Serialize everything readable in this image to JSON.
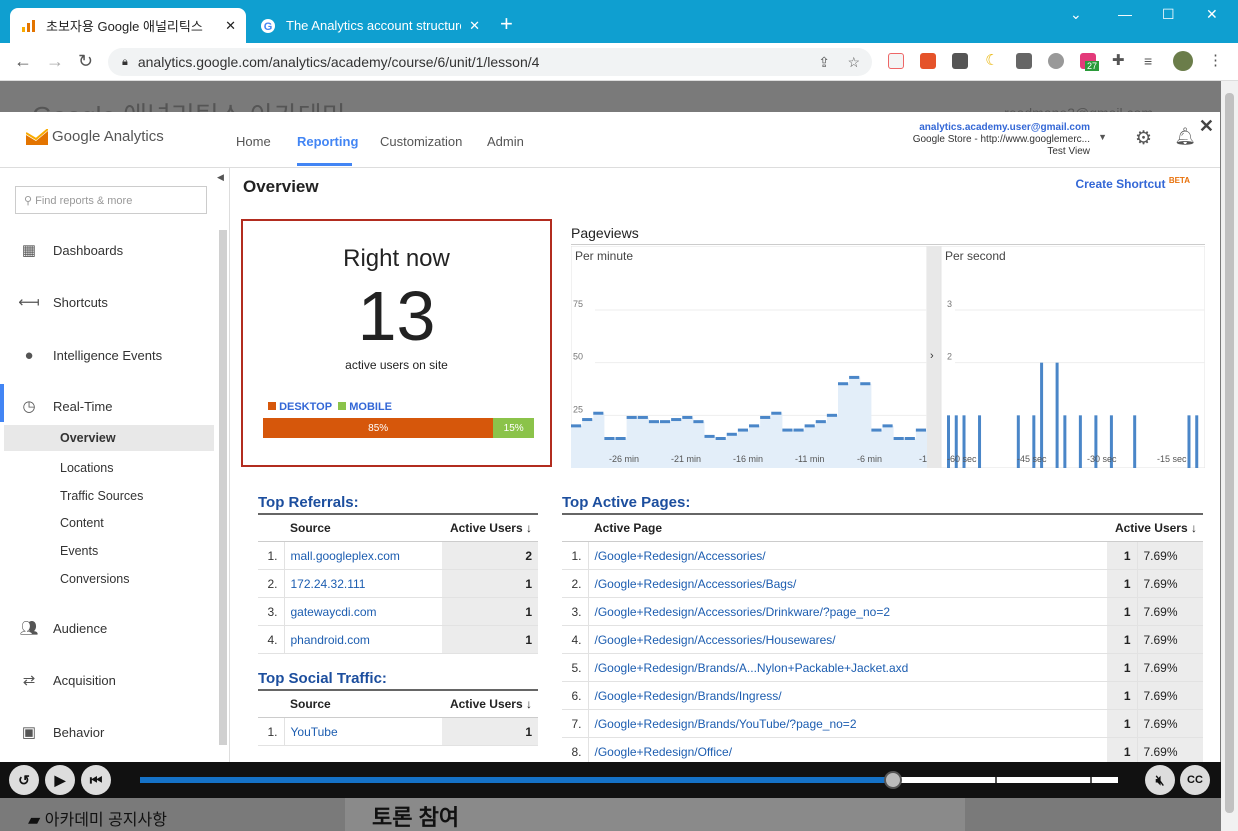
{
  "browser": {
    "tabs": [
      {
        "title": "초보자용 Google 애널리틱스",
        "active": true
      },
      {
        "title": "The Analytics account structure",
        "active": false
      }
    ],
    "url": "analytics.google.com/analytics/academy/course/6/unit/1/lesson/4",
    "extension_badge": "27"
  },
  "background": {
    "academy_title": "Google 애널리틱스 아카데미",
    "account_email": "readmane3@gmail.com"
  },
  "ga": {
    "logo_text": "Google Analytics",
    "nav": [
      "Home",
      "Reporting",
      "Customization",
      "Admin"
    ],
    "user": {
      "email": "analytics.academy.user@gmail.com",
      "property": "Google Store - http://www.googlemerc...",
      "view": "Test View"
    },
    "sidebar": {
      "search_placeholder": "Find reports & more",
      "items": [
        "Dashboards",
        "Shortcuts",
        "Intelligence Events",
        "Real-Time"
      ],
      "realtime_sub": [
        "Overview",
        "Locations",
        "Traffic Sources",
        "Content",
        "Events",
        "Conversions"
      ],
      "more": [
        "Audience",
        "Acquisition",
        "Behavior"
      ]
    },
    "main": {
      "title": "Overview",
      "shortcut": "Create Shortcut",
      "shortcut_badge": "BETA",
      "right_now": {
        "title": "Right now",
        "count": "13",
        "subtitle": "active users on site",
        "desktop_label": "DESKTOP",
        "mobile_label": "MOBILE",
        "desktop_pct": "85%",
        "mobile_pct": "15%",
        "desktop_fraction": 0.85
      },
      "pageviews": {
        "title": "Pageviews",
        "per_minute": "Per minute",
        "per_second": "Per second"
      },
      "top_referrals": {
        "title": "Top Referrals:",
        "col1": "Source",
        "col2": "Active Users",
        "rows": [
          {
            "n": "1.",
            "source": "mall.googleplex.com",
            "users": "2"
          },
          {
            "n": "2.",
            "source": "172.24.32.111",
            "users": "1"
          },
          {
            "n": "3.",
            "source": "gatewaycdi.com",
            "users": "1"
          },
          {
            "n": "4.",
            "source": "phandroid.com",
            "users": "1"
          }
        ]
      },
      "top_social": {
        "title": "Top Social Traffic:",
        "col1": "Source",
        "col2": "Active Users",
        "rows": [
          {
            "n": "1.",
            "source": "YouTube",
            "users": "1"
          }
        ]
      },
      "top_pages": {
        "title": "Top Active Pages:",
        "col1": "Active Page",
        "col2": "Active Users",
        "rows": [
          {
            "n": "1.",
            "page": "/Google+Redesign/Accessories/",
            "users": "1",
            "pct": "7.69%"
          },
          {
            "n": "2.",
            "page": "/Google+Redesign/Accessories/Bags/",
            "users": "1",
            "pct": "7.69%"
          },
          {
            "n": "3.",
            "page": "/Google+Redesign/Accessories/Drinkware/?page_no=2",
            "users": "1",
            "pct": "7.69%"
          },
          {
            "n": "4.",
            "page": "/Google+Redesign/Accessories/Housewares/",
            "users": "1",
            "pct": "7.69%"
          },
          {
            "n": "5.",
            "page": "/Google+Redesign/Brands/A...Nylon+Packable+Jacket.axd",
            "users": "1",
            "pct": "7.69%"
          },
          {
            "n": "6.",
            "page": "/Google+Redesign/Brands/Ingress/",
            "users": "1",
            "pct": "7.69%"
          },
          {
            "n": "7.",
            "page": "/Google+Redesign/Brands/YouTube/?page_no=2",
            "users": "1",
            "pct": "7.69%"
          },
          {
            "n": "8.",
            "page": "/Google+Redesign/Office/",
            "users": "1",
            "pct": "7.69%"
          }
        ]
      }
    }
  },
  "chart_data": [
    {
      "type": "area",
      "title": "Per minute",
      "ylim": [
        0,
        75
      ],
      "yticks": [
        "25",
        "50",
        "75"
      ],
      "xticks": [
        "-26 min",
        "-21 min",
        "-16 min",
        "-11 min",
        "-6 min",
        "-1"
      ],
      "values": [
        20,
        23,
        26,
        14,
        14,
        24,
        24,
        22,
        22,
        23,
        24,
        22,
        15,
        14,
        16,
        18,
        20,
        24,
        26,
        18,
        18,
        20,
        22,
        25,
        40,
        43,
        40,
        18,
        20,
        14,
        14,
        18
      ]
    },
    {
      "type": "bar",
      "title": "Per second",
      "ylim": [
        0,
        3
      ],
      "yticks": [
        "2",
        "3"
      ],
      "xticks": [
        "-60 sec",
        "-45 sec",
        "-30 sec",
        "-15 sec"
      ],
      "values": [
        1,
        1,
        1,
        0,
        1,
        0,
        0,
        0,
        0,
        1,
        0,
        1,
        2,
        0,
        2,
        1,
        0,
        1,
        0,
        1,
        0,
        1,
        0,
        0,
        1,
        0,
        0,
        0,
        0,
        0,
        0,
        1,
        1
      ]
    }
  ],
  "player": {
    "progress": 0.77,
    "notice": "아카데미 공지사항",
    "discussion": "토론 참여"
  },
  "colors": {
    "chrome_tab_bar": "#0f9fd0",
    "desktop": "#d6570b",
    "mobile": "#8bc34a",
    "highlight_border": "#b22c1f",
    "chart_line": "#4a86c8"
  }
}
